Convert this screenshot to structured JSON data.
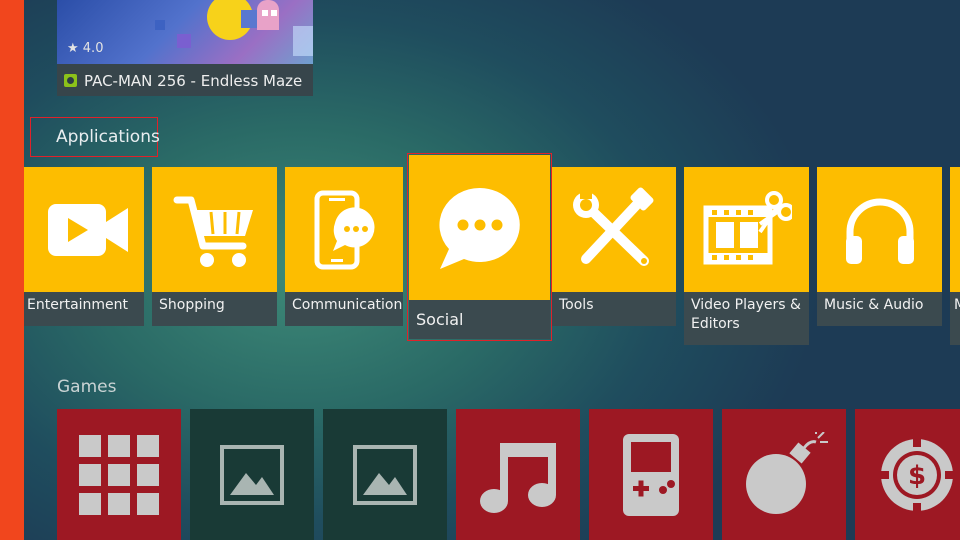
{
  "featured": {
    "rating": "★ 4.0",
    "title": "PAC-MAN 256 - Endless Maze",
    "badge_icon": "app-badge-icon"
  },
  "sections": {
    "applications": "Applications",
    "games": "Games"
  },
  "categories": [
    {
      "label": "Entertainment",
      "icon": "video-camera-icon"
    },
    {
      "label": "Shopping",
      "icon": "shopping-cart-icon"
    },
    {
      "label": "Communication",
      "icon": "phone-chat-icon"
    },
    {
      "label": "Social",
      "icon": "chat-bubble-icon",
      "focused": true
    },
    {
      "label": "Tools",
      "icon": "tools-icon"
    },
    {
      "label": "Video Players & Editors",
      "icon": "film-scissors-icon"
    },
    {
      "label": "Music & Audio",
      "icon": "headphones-icon"
    },
    {
      "label": "M",
      "icon": "partial-tile"
    }
  ],
  "games": [
    {
      "icon": "grid-icon",
      "color": "#9d1823"
    },
    {
      "icon": "image-placeholder-icon",
      "color": "#193a36"
    },
    {
      "icon": "image-placeholder-icon",
      "color": "#193a36"
    },
    {
      "icon": "music-note-icon",
      "color": "#9d1823"
    },
    {
      "icon": "gameboy-icon",
      "color": "#9d1823"
    },
    {
      "icon": "bomb-icon",
      "color": "#9d1823"
    },
    {
      "icon": "casino-chip-icon",
      "color": "#9d1823"
    }
  ],
  "colors": {
    "accent_bar": "#f1461d",
    "tile_yellow": "#fdbd00",
    "focus_outline": "#e0222a"
  }
}
